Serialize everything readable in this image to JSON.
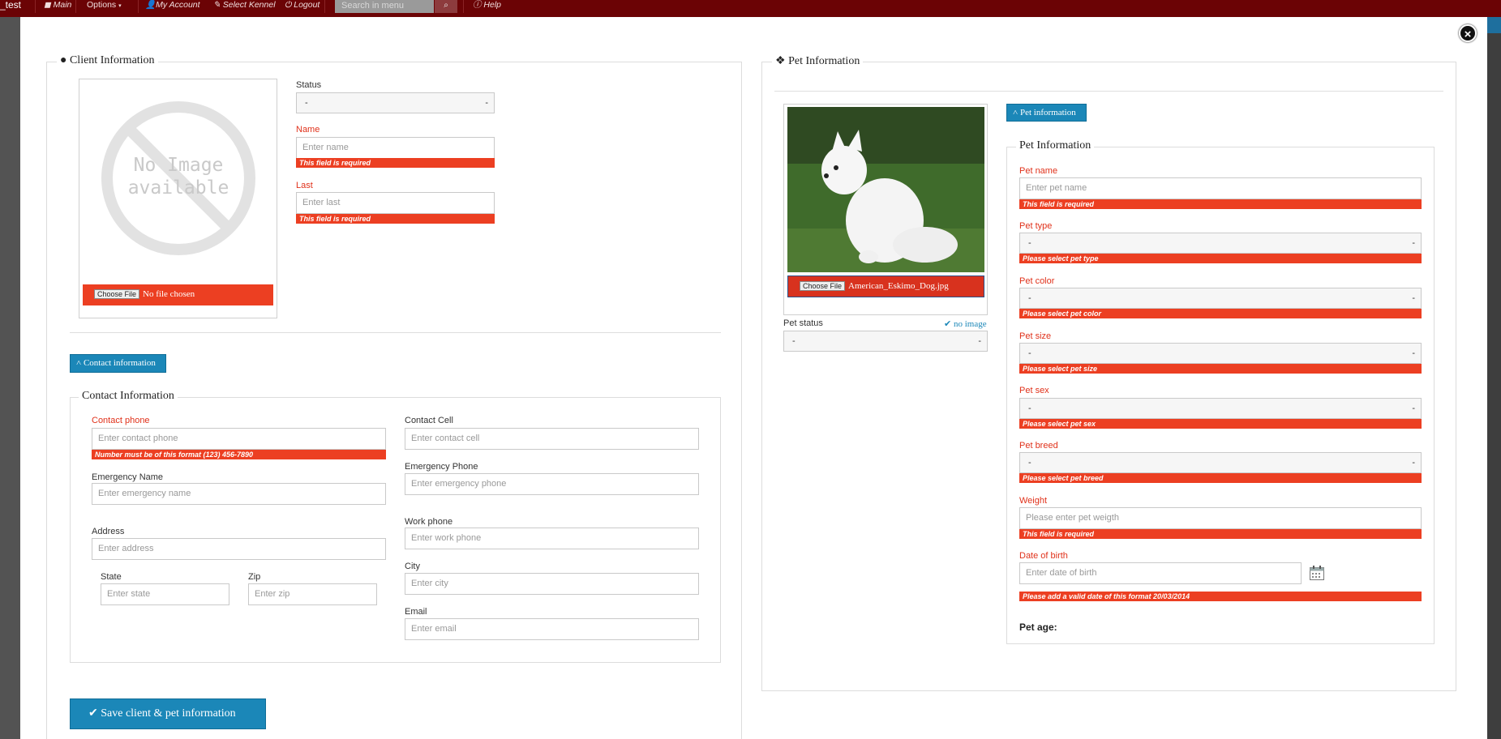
{
  "topnav": {
    "brand": "_test",
    "items": [
      "Main",
      "Options",
      "My Account",
      "Select Kennel",
      "Logout",
      "Help"
    ],
    "search_placeholder": "Search in menu"
  },
  "client": {
    "legend": "Client Information",
    "no_image_line1": "No Image",
    "no_image_line2": "available",
    "choose_file": "Choose File",
    "file_status": "No file chosen",
    "status_label": "Status",
    "status_value": "-",
    "name_label": "Name",
    "name_placeholder": "Enter name",
    "name_error": "This field is required",
    "last_label": "Last",
    "last_placeholder": "Enter last",
    "last_error": "This field is required"
  },
  "contact_toggle": "Contact information",
  "contact": {
    "legend": "Contact Information",
    "phone_label": "Contact phone",
    "phone_placeholder": "Enter contact phone",
    "phone_error": "Number must be of this format (123) 456-7890",
    "cell_label": "Contact Cell",
    "cell_placeholder": "Enter contact cell",
    "emname_label": "Emergency Name",
    "emname_placeholder": "Enter emergency name",
    "emphone_label": "Emergency Phone",
    "emphone_placeholder": "Enter emergency phone",
    "address_label": "Address",
    "address_placeholder": "Enter address",
    "work_label": "Work phone",
    "work_placeholder": "Enter work phone",
    "city_label": "City",
    "city_placeholder": "Enter city",
    "state_label": "State",
    "state_placeholder": "Enter state",
    "zip_label": "Zip",
    "zip_placeholder": "Enter zip",
    "email_label": "Email",
    "email_placeholder": "Enter email"
  },
  "save_button": "Save client & pet information",
  "pet": {
    "legend": "Pet Information",
    "choose_file": "Choose File",
    "file_name": "American_Eskimo_Dog.jpg",
    "no_image_link": "no image",
    "status_label": "Pet status",
    "status_value": "-",
    "toggle": "Pet information",
    "inner_legend": "Pet Information",
    "name_label": "Pet name",
    "name_placeholder": "Enter pet name",
    "name_error": "This field is required",
    "type_label": "Pet type",
    "type_value": "-",
    "type_error": "Please select pet type",
    "color_label": "Pet color",
    "color_value": "-",
    "color_error": "Please select pet color",
    "size_label": "Pet size",
    "size_value": "-",
    "size_error": "Please select pet size",
    "sex_label": "Pet sex",
    "sex_value": "-",
    "sex_error": "Please select pet sex",
    "breed_label": "Pet breed",
    "breed_value": "-",
    "breed_error": "Please select pet breed",
    "weight_label": "Weight",
    "weight_placeholder": "Please enter pet weigth",
    "weight_error": "This field is required",
    "dob_label": "Date of birth",
    "dob_placeholder": "Enter date of birth",
    "dob_error": "Please add a valid date of this format 20/03/2014",
    "age_label": "Pet age:"
  },
  "colors": {
    "nav": "#6b0305",
    "error": "#ec3f22",
    "primary": "#1b87b8"
  }
}
